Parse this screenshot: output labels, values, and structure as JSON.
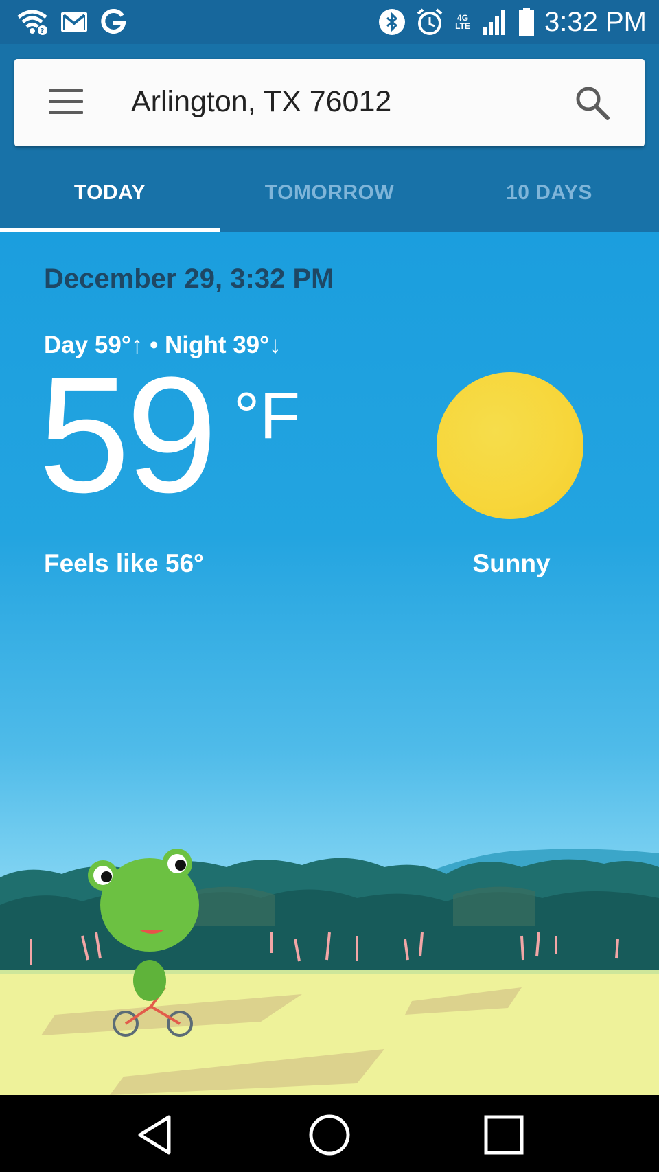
{
  "status_bar": {
    "time": "3:32 PM",
    "network": "4G LTE",
    "icons": [
      "wifi-icon",
      "gmail-icon",
      "google-icon",
      "bluetooth-icon",
      "alarm-icon",
      "signal-icon",
      "battery-icon"
    ]
  },
  "search": {
    "location": "Arlington, TX 76012"
  },
  "tabs": [
    {
      "label": "TODAY",
      "active": true
    },
    {
      "label": "TOMORROW",
      "active": false
    },
    {
      "label": "10 DAYS",
      "active": false
    }
  ],
  "weather": {
    "datetime": "December 29, 3:32 PM",
    "day_night": "Day 59°↑ • Night 39°↓",
    "temperature": "59",
    "unit": "°F",
    "feels_like": "Feels like 56°",
    "condition": "Sunny",
    "condition_icon": "sun-icon"
  },
  "colors": {
    "header": "#1872a8",
    "status_bar": "#17679c",
    "sky": "#1b9ede",
    "sun": "#f7d63a",
    "grass": "#eef29a"
  },
  "nav": [
    "back-icon",
    "home-icon",
    "recents-icon"
  ]
}
